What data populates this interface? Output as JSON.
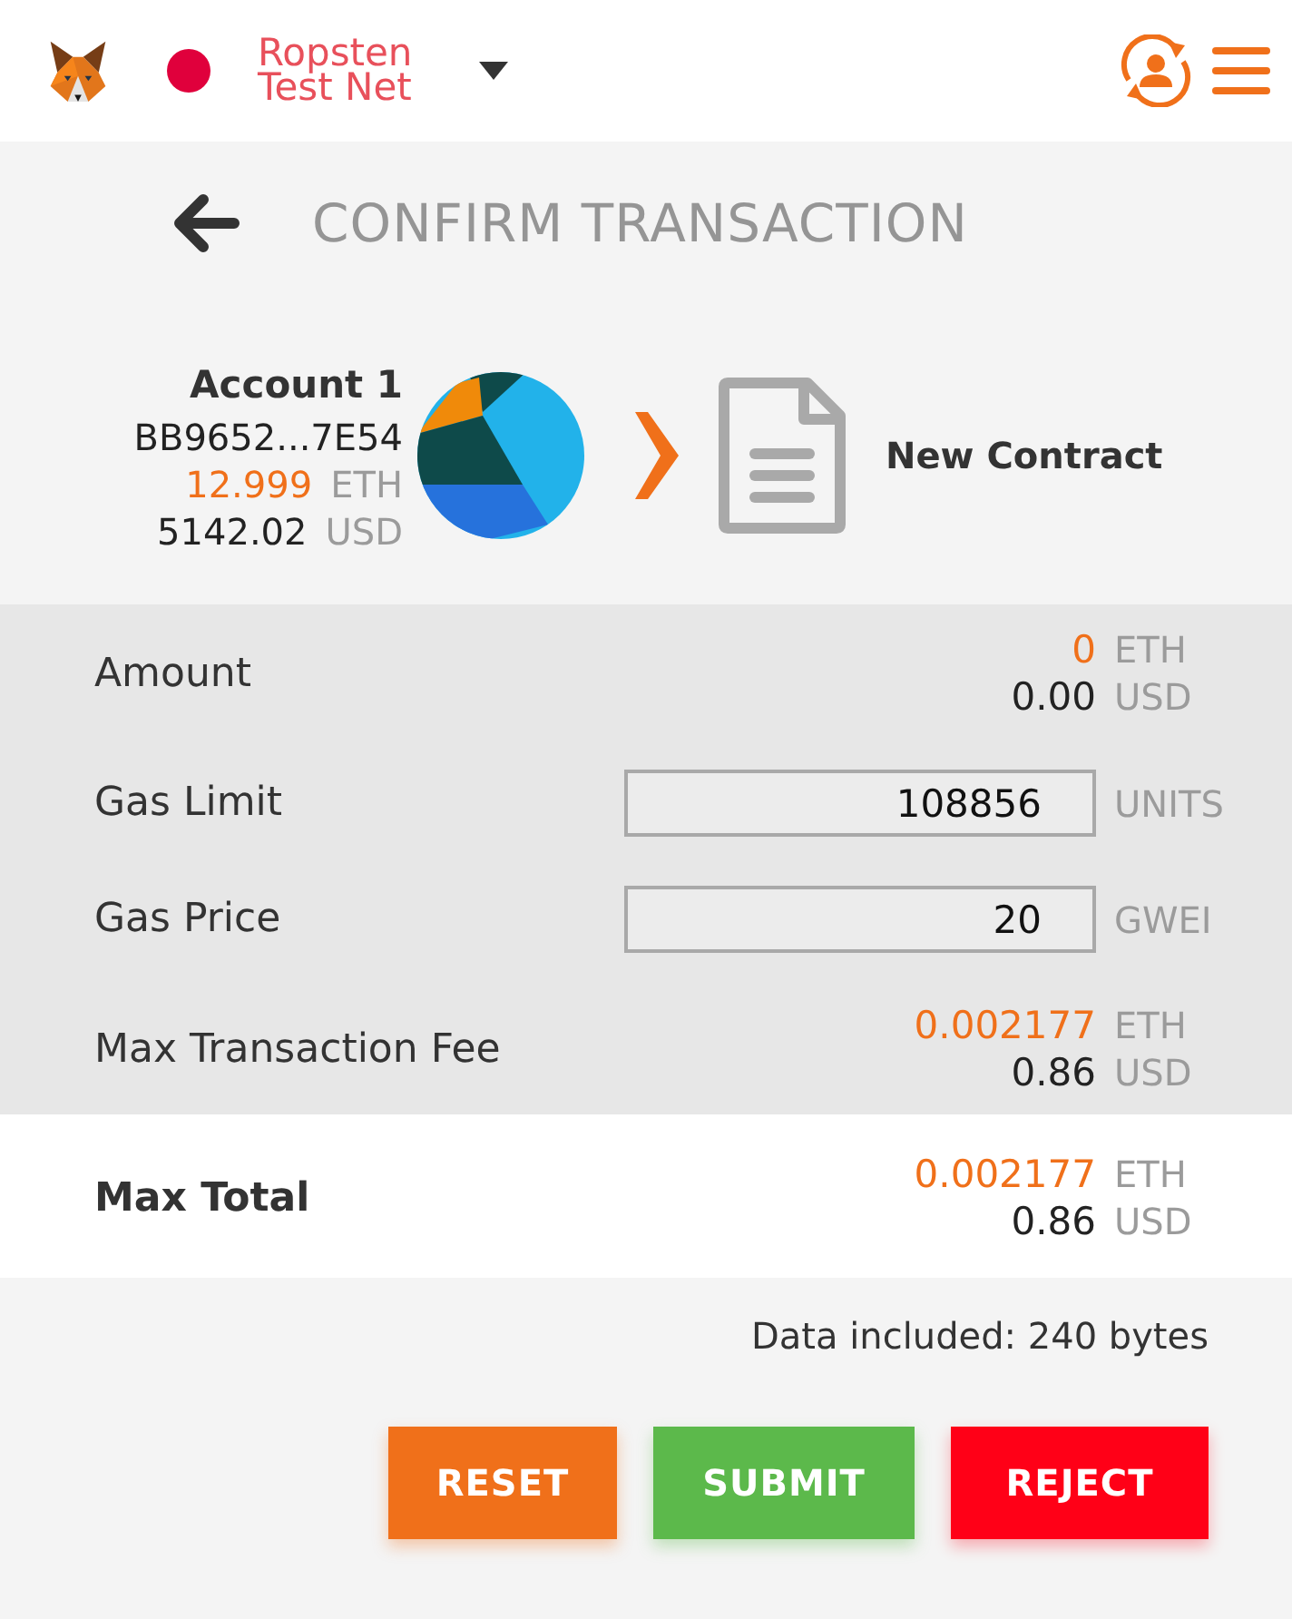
{
  "header": {
    "network": "Ropsten Test Net"
  },
  "title": "CONFIRM TRANSACTION",
  "sender": {
    "account_name": "Account 1",
    "address": "BB9652...7E54",
    "balance_eth": "12.999",
    "eth_unit": "ETH",
    "balance_usd": "5142.02",
    "usd_unit": "USD"
  },
  "recipient": {
    "name": "New Contract"
  },
  "details": [
    {
      "kind": "value",
      "label": "Amount",
      "eth": "0",
      "eth_unit": "ETH",
      "usd": "0.00",
      "usd_unit": "USD"
    },
    {
      "kind": "input",
      "label": "Gas Limit",
      "value": "108856",
      "unit": "UNITS"
    },
    {
      "kind": "input",
      "label": "Gas Price",
      "value": "20",
      "unit": "GWEI"
    },
    {
      "kind": "value",
      "label": "Max Transaction Fee",
      "eth": "0.002177",
      "eth_unit": "ETH",
      "usd": "0.86",
      "usd_unit": "USD"
    }
  ],
  "total": {
    "label": "Max Total",
    "eth": "0.002177",
    "eth_unit": "ETH",
    "usd": "0.86",
    "usd_unit": "USD"
  },
  "data_note": "Data included: 240 bytes",
  "buttons": [
    {
      "kind": "reset",
      "label": "RESET"
    },
    {
      "kind": "submit",
      "label": "SUBMIT"
    },
    {
      "kind": "reject",
      "label": "REJECT"
    }
  ]
}
